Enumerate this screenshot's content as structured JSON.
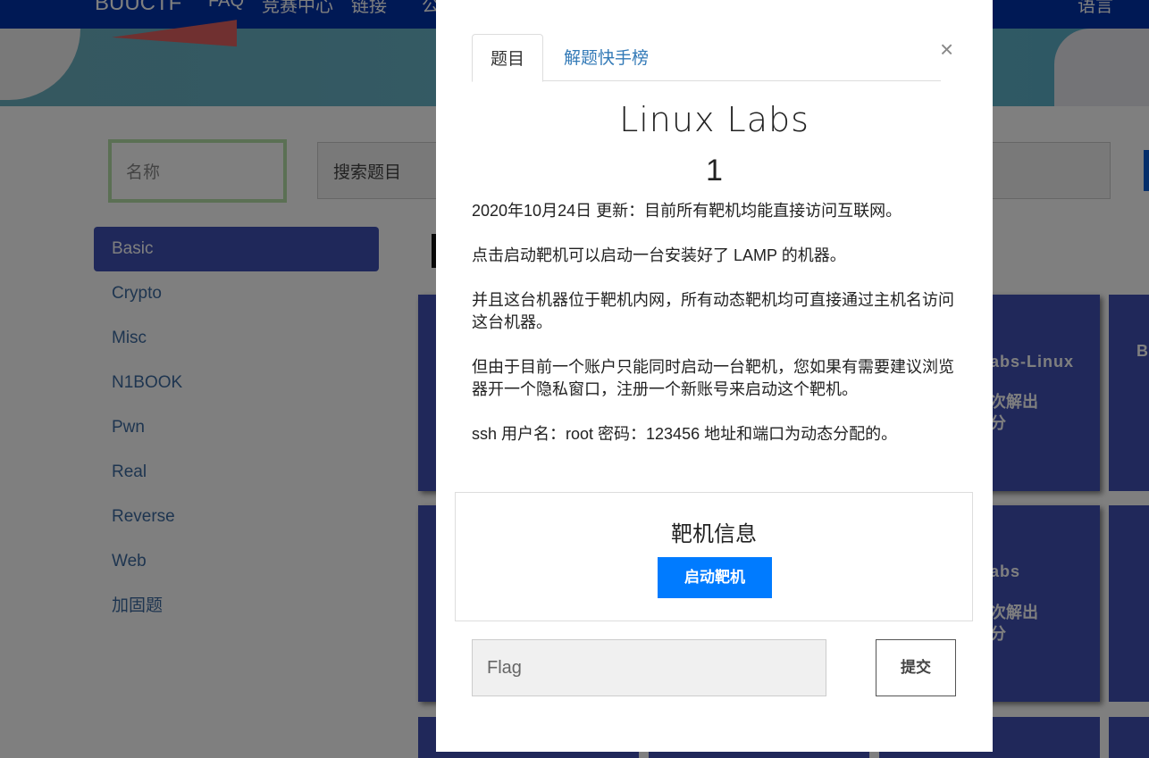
{
  "nav": {
    "brand": "BUUCTF",
    "items": [
      "FAQ",
      "竞赛中心",
      "链接",
      "公"
    ],
    "language": "语言"
  },
  "filters": {
    "name_placeholder": "名称",
    "search_placeholder": "搜索题目"
  },
  "sidebar": {
    "items": [
      {
        "label": "Basic",
        "active": true
      },
      {
        "label": "Crypto"
      },
      {
        "label": "Misc"
      },
      {
        "label": "N1BOOK"
      },
      {
        "label": "Pwn"
      },
      {
        "label": "Real"
      },
      {
        "label": "Reverse"
      },
      {
        "label": "Web"
      },
      {
        "label": "加固题"
      }
    ]
  },
  "cards": [
    {
      "title": "abs-Linux",
      "solves": "次解出",
      "points": "分"
    },
    {
      "title": "B"
    },
    {
      "title": "abs",
      "solves": "次解出",
      "points": "分"
    }
  ],
  "modal": {
    "tabs": [
      "题目",
      "解题快手榜"
    ],
    "close": "×",
    "title": "Linux Labs",
    "value": "1",
    "description": [
      "2020年10月24日 更新：目前所有靶机均能直接访问互联网。",
      "点击启动靶机可以启动一台安装好了 LAMP 的机器。",
      "并且这台机器位于靶机内网，所有动态靶机均可直接通过主机名访问这台机器。",
      "但由于目前一个账户只能同时启动一台靶机，您如果有需要建议浏览器开一个隐私窗口，注册一个新账号来启动这个靶机。",
      "ssh 用户名：root 密码：123456 地址和端口为动态分配的。"
    ],
    "instance_heading": "靶机信息",
    "start_button": "启动靶机",
    "flag_placeholder": "Flag",
    "submit_button": "提交"
  },
  "colors": {
    "accent": "#007bff",
    "sidebar_active": "#3f51b5",
    "card": "#4051b5",
    "tab_link": "#337ab7"
  }
}
